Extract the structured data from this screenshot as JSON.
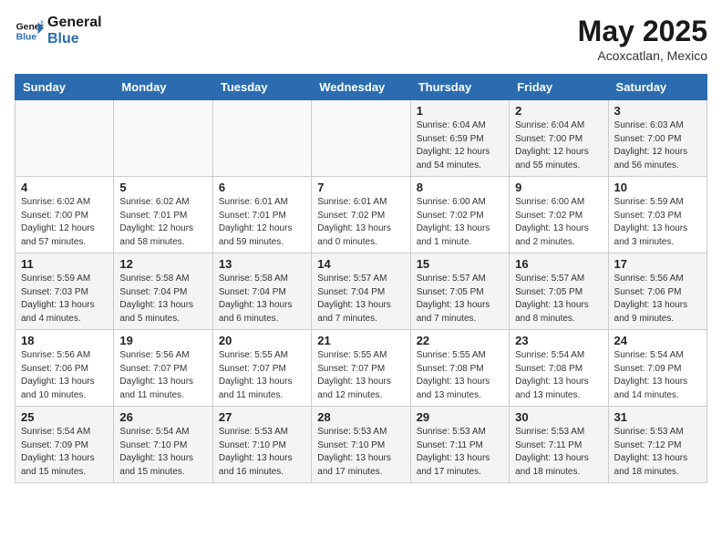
{
  "header": {
    "logo_line1": "General",
    "logo_line2": "Blue",
    "month": "May 2025",
    "location": "Acoxcatlan, Mexico"
  },
  "weekdays": [
    "Sunday",
    "Monday",
    "Tuesday",
    "Wednesday",
    "Thursday",
    "Friday",
    "Saturday"
  ],
  "weeks": [
    [
      {
        "day": "",
        "info": ""
      },
      {
        "day": "",
        "info": ""
      },
      {
        "day": "",
        "info": ""
      },
      {
        "day": "",
        "info": ""
      },
      {
        "day": "1",
        "info": "Sunrise: 6:04 AM\nSunset: 6:59 PM\nDaylight: 12 hours\nand 54 minutes."
      },
      {
        "day": "2",
        "info": "Sunrise: 6:04 AM\nSunset: 7:00 PM\nDaylight: 12 hours\nand 55 minutes."
      },
      {
        "day": "3",
        "info": "Sunrise: 6:03 AM\nSunset: 7:00 PM\nDaylight: 12 hours\nand 56 minutes."
      }
    ],
    [
      {
        "day": "4",
        "info": "Sunrise: 6:02 AM\nSunset: 7:00 PM\nDaylight: 12 hours\nand 57 minutes."
      },
      {
        "day": "5",
        "info": "Sunrise: 6:02 AM\nSunset: 7:01 PM\nDaylight: 12 hours\nand 58 minutes."
      },
      {
        "day": "6",
        "info": "Sunrise: 6:01 AM\nSunset: 7:01 PM\nDaylight: 12 hours\nand 59 minutes."
      },
      {
        "day": "7",
        "info": "Sunrise: 6:01 AM\nSunset: 7:02 PM\nDaylight: 13 hours\nand 0 minutes."
      },
      {
        "day": "8",
        "info": "Sunrise: 6:00 AM\nSunset: 7:02 PM\nDaylight: 13 hours\nand 1 minute."
      },
      {
        "day": "9",
        "info": "Sunrise: 6:00 AM\nSunset: 7:02 PM\nDaylight: 13 hours\nand 2 minutes."
      },
      {
        "day": "10",
        "info": "Sunrise: 5:59 AM\nSunset: 7:03 PM\nDaylight: 13 hours\nand 3 minutes."
      }
    ],
    [
      {
        "day": "11",
        "info": "Sunrise: 5:59 AM\nSunset: 7:03 PM\nDaylight: 13 hours\nand 4 minutes."
      },
      {
        "day": "12",
        "info": "Sunrise: 5:58 AM\nSunset: 7:04 PM\nDaylight: 13 hours\nand 5 minutes."
      },
      {
        "day": "13",
        "info": "Sunrise: 5:58 AM\nSunset: 7:04 PM\nDaylight: 13 hours\nand 6 minutes."
      },
      {
        "day": "14",
        "info": "Sunrise: 5:57 AM\nSunset: 7:04 PM\nDaylight: 13 hours\nand 7 minutes."
      },
      {
        "day": "15",
        "info": "Sunrise: 5:57 AM\nSunset: 7:05 PM\nDaylight: 13 hours\nand 7 minutes."
      },
      {
        "day": "16",
        "info": "Sunrise: 5:57 AM\nSunset: 7:05 PM\nDaylight: 13 hours\nand 8 minutes."
      },
      {
        "day": "17",
        "info": "Sunrise: 5:56 AM\nSunset: 7:06 PM\nDaylight: 13 hours\nand 9 minutes."
      }
    ],
    [
      {
        "day": "18",
        "info": "Sunrise: 5:56 AM\nSunset: 7:06 PM\nDaylight: 13 hours\nand 10 minutes."
      },
      {
        "day": "19",
        "info": "Sunrise: 5:56 AM\nSunset: 7:07 PM\nDaylight: 13 hours\nand 11 minutes."
      },
      {
        "day": "20",
        "info": "Sunrise: 5:55 AM\nSunset: 7:07 PM\nDaylight: 13 hours\nand 11 minutes."
      },
      {
        "day": "21",
        "info": "Sunrise: 5:55 AM\nSunset: 7:07 PM\nDaylight: 13 hours\nand 12 minutes."
      },
      {
        "day": "22",
        "info": "Sunrise: 5:55 AM\nSunset: 7:08 PM\nDaylight: 13 hours\nand 13 minutes."
      },
      {
        "day": "23",
        "info": "Sunrise: 5:54 AM\nSunset: 7:08 PM\nDaylight: 13 hours\nand 13 minutes."
      },
      {
        "day": "24",
        "info": "Sunrise: 5:54 AM\nSunset: 7:09 PM\nDaylight: 13 hours\nand 14 minutes."
      }
    ],
    [
      {
        "day": "25",
        "info": "Sunrise: 5:54 AM\nSunset: 7:09 PM\nDaylight: 13 hours\nand 15 minutes."
      },
      {
        "day": "26",
        "info": "Sunrise: 5:54 AM\nSunset: 7:10 PM\nDaylight: 13 hours\nand 15 minutes."
      },
      {
        "day": "27",
        "info": "Sunrise: 5:53 AM\nSunset: 7:10 PM\nDaylight: 13 hours\nand 16 minutes."
      },
      {
        "day": "28",
        "info": "Sunrise: 5:53 AM\nSunset: 7:10 PM\nDaylight: 13 hours\nand 17 minutes."
      },
      {
        "day": "29",
        "info": "Sunrise: 5:53 AM\nSunset: 7:11 PM\nDaylight: 13 hours\nand 17 minutes."
      },
      {
        "day": "30",
        "info": "Sunrise: 5:53 AM\nSunset: 7:11 PM\nDaylight: 13 hours\nand 18 minutes."
      },
      {
        "day": "31",
        "info": "Sunrise: 5:53 AM\nSunset: 7:12 PM\nDaylight: 13 hours\nand 18 minutes."
      }
    ]
  ]
}
